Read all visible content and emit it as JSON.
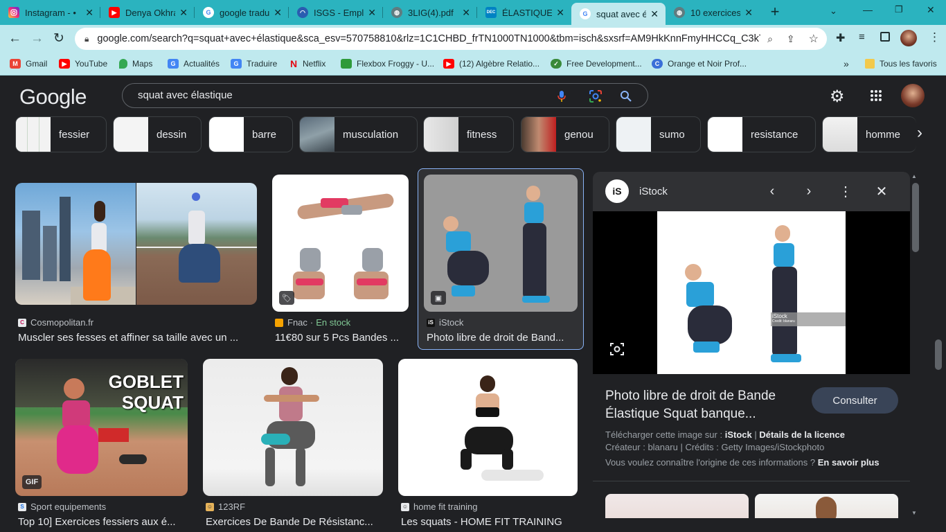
{
  "tabs": [
    {
      "title": "Instagram - •",
      "icon": "instagram-icon",
      "color": "#d6249f"
    },
    {
      "title": "Denya Okhra",
      "icon": "youtube-icon",
      "color": "#ff0000"
    },
    {
      "title": "google tradu",
      "icon": "google-icon",
      "color": "#4285f4"
    },
    {
      "title": "ISGS - Empl",
      "icon": "isgs-icon",
      "color": "#2a5db0"
    },
    {
      "title": "3LIG(4).pdf",
      "icon": "globe-icon",
      "color": "#5f7c80"
    },
    {
      "title": "ÉLASTIQUE",
      "icon": "decathlon-icon",
      "color": "#0082c3"
    },
    {
      "title": "squat avec é",
      "icon": "google-icon",
      "color": "#4285f4"
    },
    {
      "title": "10 exercices",
      "icon": "globe-icon",
      "color": "#5f7c80"
    }
  ],
  "new_tab_label": "+",
  "url": "google.com/search?q=squat+avec+élastique&sca_esv=570758810&rlz=1C1CHBD_frTN1000TN1000&tbm=isch&sxsrf=AM9HkKnnFmyHHCCq_C3kTYkf...",
  "bookmarks": [
    {
      "label": "Gmail",
      "icon": "gmail-icon",
      "color": "#ea4335"
    },
    {
      "label": "YouTube",
      "icon": "youtube-icon",
      "color": "#ff0000"
    },
    {
      "label": "Maps",
      "icon": "maps-icon",
      "color": "#34a853"
    },
    {
      "label": "Actualités",
      "icon": "news-icon",
      "color": "#4285f4"
    },
    {
      "label": "Traduire",
      "icon": "translate-icon",
      "color": "#4285f4"
    },
    {
      "label": "Netflix",
      "icon": "netflix-icon",
      "color": "#e50914"
    },
    {
      "label": "Flexbox Froggy - U...",
      "icon": "frog-icon",
      "color": "#2e9a3a"
    },
    {
      "label": "(12) Algèbre Relatio...",
      "icon": "youtube-icon",
      "color": "#ff0000"
    },
    {
      "label": "Free Development...",
      "icon": "fcc-icon",
      "color": "#3a8a3a"
    },
    {
      "label": "Orange et Noir Prof...",
      "icon": "canva-icon",
      "color": "#3a6fd8"
    }
  ],
  "all_bookmarks_label": "Tous les favoris",
  "logo_text": "Google",
  "search_query": "squat avec élastique",
  "chips": [
    {
      "label": "fessier"
    },
    {
      "label": "dessin"
    },
    {
      "label": "barre"
    },
    {
      "label": "musculation"
    },
    {
      "label": "fitness"
    },
    {
      "label": "genou"
    },
    {
      "label": "sumo"
    },
    {
      "label": "resistance"
    },
    {
      "label": "homme"
    }
  ],
  "results": [
    {
      "source": "Cosmopolitan.fr",
      "title": "Muscler ses fesses et affiner sa taille avec un ..."
    },
    {
      "source": "Fnac",
      "stock": "En stock",
      "title": "11€80 sur 5 Pcs Bandes ..."
    },
    {
      "source": "iStock",
      "title": "Photo libre de droit de Band..."
    },
    {
      "source": "Sport equipements",
      "title": "Top 10] Exercices fessiers aux é...",
      "badge": "GIF",
      "overlay": "GOBLET SQUAT"
    },
    {
      "source": "123RF",
      "title": "Exercices De Bande De Résistanc..."
    },
    {
      "source": "home fit training",
      "title": "Les squats - HOME FIT TRAINING"
    }
  ],
  "panel": {
    "source": "iStock",
    "logo_text": "iS",
    "watermark": "iStock",
    "watermark_credit": "Credit: blanaru",
    "title_line1": "Photo libre de droit de Bande",
    "title_line2": "Élastique Squat banque...",
    "visit_label": "Consulter",
    "download_prefix": "Télécharger cette image sur :",
    "download_site": "iStock",
    "license_label": "Détails de la licence",
    "creator_prefix": "Créateur :",
    "creator": "blanaru",
    "credits_prefix": "Crédits :",
    "credits": "Getty Images/iStockphoto",
    "origin_question": "Vous voulez connaître l'origine de ces informations ?",
    "learn_more": "En savoir plus"
  },
  "colors": {
    "accent_blue": "#8ab4f8",
    "stock_green": "#81c995",
    "dark_bg": "#202124",
    "tab_bg": "#2bb3bf",
    "toolbar_bg": "#bfe9ee"
  }
}
